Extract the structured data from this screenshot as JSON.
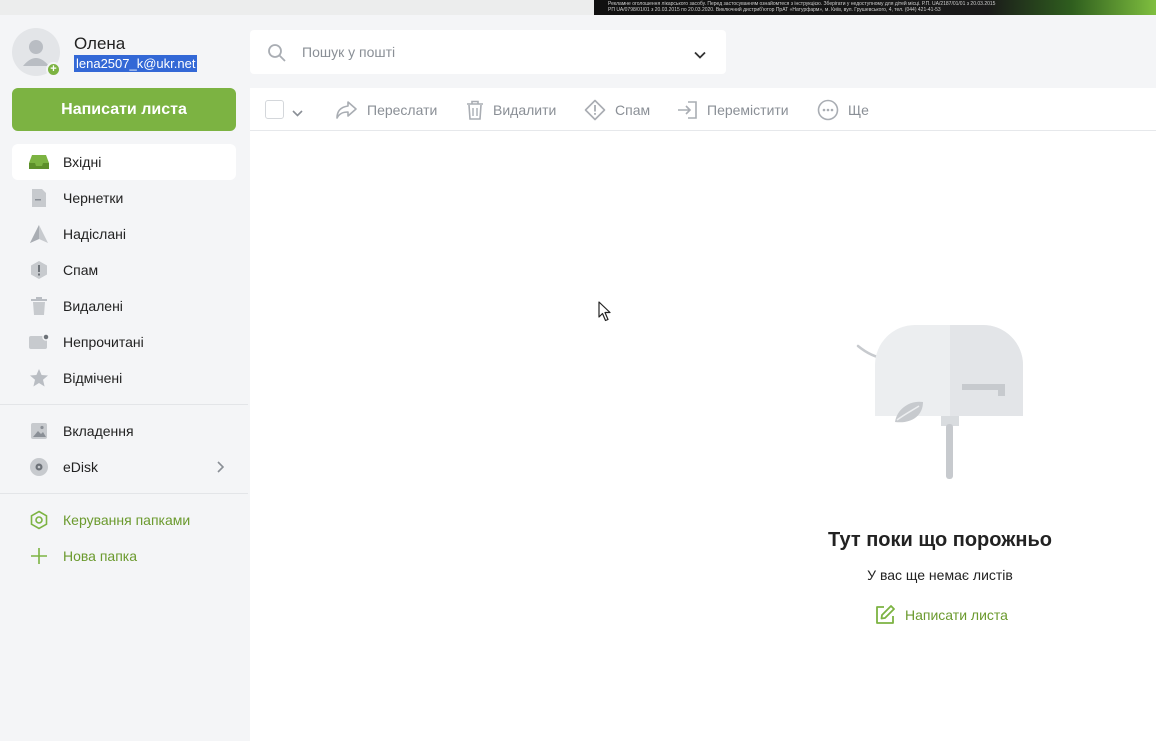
{
  "ad": {
    "line1": "Рекламне оголошення лікарського засобу. Перед застосуванням ознайомтеся з інструкцією. Зберігати у недоступному для дітей місці. Р.П. UA/2187/01/01 з 20.03.2015",
    "line2": "РП UA/0798/01/01 з 20.03.2015 по 20.03.2020. Виключний дистриб'ютор ПрАТ «Натурфарм», м. Київ, вул. Грушевського, 4, тел. (044) 421-41-53"
  },
  "profile": {
    "name": "Олена",
    "email": "lena2507_k@ukr.net"
  },
  "compose_label": "Написати листа",
  "search": {
    "placeholder": "Пошук у пошті"
  },
  "nav": {
    "items": [
      {
        "label": "Вхідні",
        "icon": "inbox-icon"
      },
      {
        "label": "Чернетки",
        "icon": "draft-icon"
      },
      {
        "label": "Надіслані",
        "icon": "sent-icon"
      },
      {
        "label": "Спам",
        "icon": "spam-icon"
      },
      {
        "label": "Видалені",
        "icon": "trash-icon"
      },
      {
        "label": "Непрочитані",
        "icon": "unread-icon"
      },
      {
        "label": "Відмічені",
        "icon": "star-icon"
      }
    ],
    "extras": [
      {
        "label": "Вкладення",
        "icon": "image-icon"
      },
      {
        "label": "eDisk",
        "icon": "disk-icon"
      }
    ],
    "folders": [
      {
        "label": "Керування папками",
        "icon": "folder-settings-icon"
      },
      {
        "label": "Нова папка",
        "icon": "plus-icon"
      }
    ]
  },
  "toolbar": {
    "forward": "Переслати",
    "delete": "Видалити",
    "spam": "Спам",
    "move": "Перемістити",
    "more": "Ще"
  },
  "empty": {
    "title": "Тут поки що порожньо",
    "subtitle": "У вас ще немає листів",
    "compose": "Написати листа"
  },
  "colors": {
    "accent": "#7cb342",
    "accent_text": "#6b9a2e",
    "muted": "#8a8f96",
    "selection": "#3368d6"
  }
}
